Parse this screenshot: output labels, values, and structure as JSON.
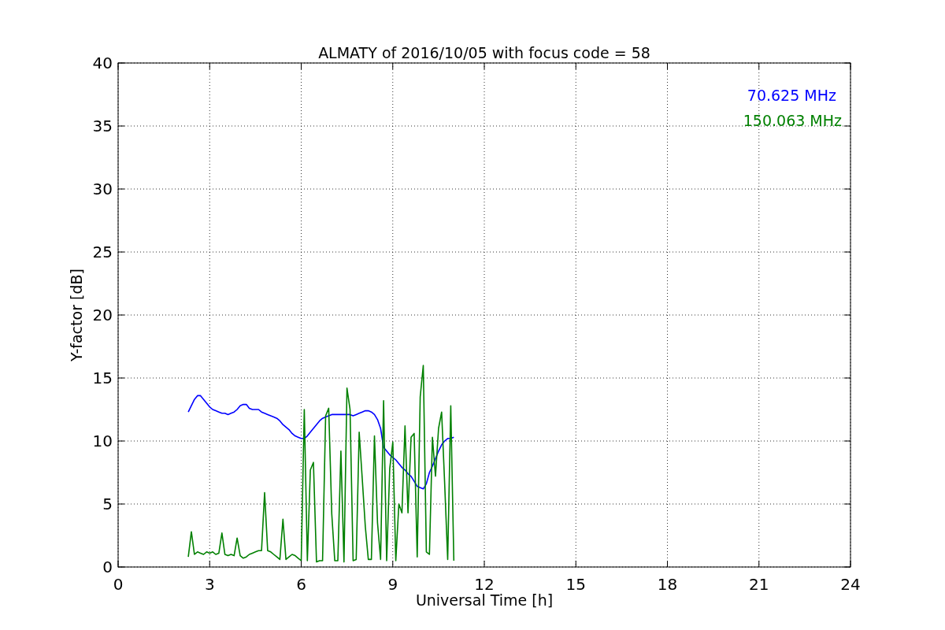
{
  "chart_data": {
    "type": "line",
    "title": "ALMATY of 2016/10/05 with focus code = 58",
    "xlabel": "Universal Time [h]",
    "ylabel": "Y-factor [dB]",
    "x": [
      2.3,
      2.4,
      2.5,
      2.6,
      2.7,
      2.8,
      2.9,
      3.0,
      3.1,
      3.2,
      3.3,
      3.4,
      3.5,
      3.6,
      3.7,
      3.8,
      3.9,
      4.0,
      4.1,
      4.2,
      4.3,
      4.4,
      4.5,
      4.6,
      4.7,
      4.8,
      4.9,
      5.0,
      5.1,
      5.2,
      5.3,
      5.4,
      5.5,
      5.6,
      5.7,
      5.8,
      5.9,
      6.0,
      6.1,
      6.2,
      6.3,
      6.4,
      6.5,
      6.6,
      6.7,
      6.8,
      6.9,
      7.0,
      7.1,
      7.2,
      7.3,
      7.4,
      7.5,
      7.6,
      7.7,
      7.8,
      7.9,
      8.0,
      8.1,
      8.2,
      8.3,
      8.4,
      8.5,
      8.6,
      8.7,
      8.8,
      8.9,
      9.0,
      9.1,
      9.2,
      9.3,
      9.4,
      9.5,
      9.6,
      9.7,
      9.8,
      9.9,
      10.0,
      10.1,
      10.2,
      10.3,
      10.4,
      10.5,
      10.6,
      10.7,
      10.8,
      10.9,
      11.0
    ],
    "series": [
      {
        "name": "70.625 MHz",
        "color": "#0000ff",
        "values": [
          12.3,
          12.8,
          13.3,
          13.6,
          13.6,
          13.3,
          13.0,
          12.7,
          12.5,
          12.4,
          12.3,
          12.2,
          12.2,
          12.1,
          12.2,
          12.3,
          12.5,
          12.8,
          12.9,
          12.9,
          12.6,
          12.5,
          12.5,
          12.5,
          12.3,
          12.2,
          12.1,
          12.0,
          11.9,
          11.8,
          11.6,
          11.3,
          11.1,
          10.9,
          10.6,
          10.4,
          10.3,
          10.2,
          10.2,
          10.4,
          10.7,
          11.0,
          11.3,
          11.6,
          11.8,
          11.9,
          12.0,
          12.1,
          12.1,
          12.1,
          12.1,
          12.1,
          12.1,
          12.1,
          12.0,
          12.1,
          12.2,
          12.3,
          12.4,
          12.4,
          12.3,
          12.1,
          11.7,
          11.0,
          9.5,
          9.2,
          8.9,
          8.7,
          8.5,
          8.2,
          7.9,
          7.7,
          7.4,
          7.2,
          6.8,
          6.4,
          6.3,
          6.2,
          6.6,
          7.5,
          8.0,
          8.6,
          9.2,
          9.7,
          10.0,
          10.2,
          10.2,
          10.3
        ]
      },
      {
        "name": "150.063 MHz",
        "color": "#008000",
        "values": [
          0.8,
          2.8,
          1.0,
          1.2,
          1.1,
          1.0,
          1.2,
          1.1,
          1.2,
          1.0,
          1.1,
          2.7,
          1.0,
          0.9,
          1.0,
          0.9,
          2.3,
          0.9,
          0.7,
          0.8,
          1.0,
          1.1,
          1.2,
          1.3,
          1.3,
          5.9,
          1.3,
          1.2,
          1.0,
          0.8,
          0.6,
          3.8,
          0.6,
          0.8,
          1.0,
          0.9,
          0.7,
          0.5,
          12.5,
          0.5,
          7.7,
          8.3,
          0.4,
          0.5,
          0.5,
          12.0,
          12.6,
          4.2,
          0.5,
          0.5,
          9.2,
          0.4,
          14.2,
          12.5,
          0.5,
          0.6,
          10.7,
          7.0,
          3.2,
          0.6,
          0.6,
          10.4,
          3.5,
          0.6,
          13.2,
          0.5,
          7.8,
          9.9,
          0.5,
          5.0,
          4.3,
          11.2,
          4.3,
          10.3,
          10.6,
          0.8,
          13.5,
          16.0,
          1.2,
          1.0,
          10.3,
          7.2,
          11.0,
          12.3,
          6.7,
          0.6,
          12.8,
          0.5
        ]
      }
    ],
    "grid": true,
    "xlim": [
      0,
      24
    ],
    "ylim": [
      0,
      40
    ],
    "xticks": [
      0,
      3,
      6,
      9,
      12,
      15,
      18,
      21,
      24
    ],
    "yticks": [
      0,
      5,
      10,
      15,
      20,
      25,
      30,
      35,
      40
    ]
  }
}
